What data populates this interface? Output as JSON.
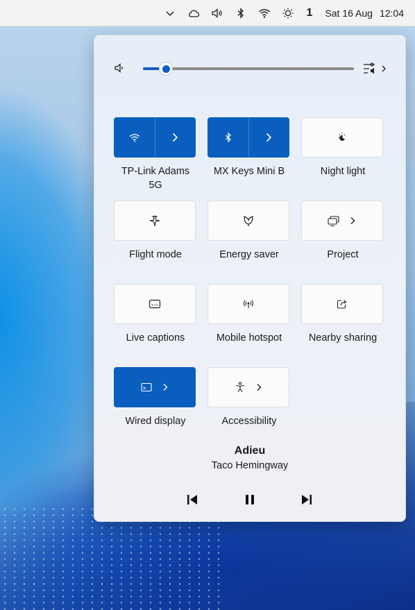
{
  "taskbar": {
    "notification_count": "1",
    "date": "Sat 16 Aug",
    "time": "12:04",
    "icons": [
      "chevron-down-icon",
      "cloud-icon",
      "volume-icon",
      "bluetooth-icon",
      "wifi-icon",
      "brightness-icon"
    ]
  },
  "volume": {
    "level": 0.11
  },
  "tiles": [
    {
      "id": "wifi",
      "label": "TP-Link Adams 5G",
      "active": true,
      "icon": "wifi-icon"
    },
    {
      "id": "bluetooth",
      "label": "MX Keys Mini B",
      "active": true,
      "icon": "bluetooth-icon"
    },
    {
      "id": "night-light",
      "label": "Night light",
      "active": false,
      "icon": "night-light-icon"
    },
    {
      "id": "flight-mode",
      "label": "Flight mode",
      "active": false,
      "icon": "airplane-icon"
    },
    {
      "id": "energy-saver",
      "label": "Energy saver",
      "active": false,
      "icon": "leaf-icon"
    },
    {
      "id": "project",
      "label": "Project",
      "active": false,
      "icon": "project-icon"
    },
    {
      "id": "live-captions",
      "label": "Live captions",
      "active": false,
      "icon": "captions-icon"
    },
    {
      "id": "mobile-hotspot",
      "label": "Mobile hotspot",
      "active": false,
      "icon": "hotspot-icon"
    },
    {
      "id": "nearby-sharing",
      "label": "Nearby sharing",
      "active": false,
      "icon": "share-icon"
    },
    {
      "id": "wired-display",
      "label": "Wired display",
      "active": true,
      "icon": "cast-icon"
    },
    {
      "id": "accessibility",
      "label": "Accessibility",
      "active": false,
      "icon": "accessibility-icon"
    }
  ],
  "media": {
    "title": "Adieu",
    "artist": "Taco Hemingway"
  },
  "colors": {
    "accent": "#0a5fbe",
    "panel": "#eaf0f7",
    "taskbar": "#f3f3f3"
  }
}
